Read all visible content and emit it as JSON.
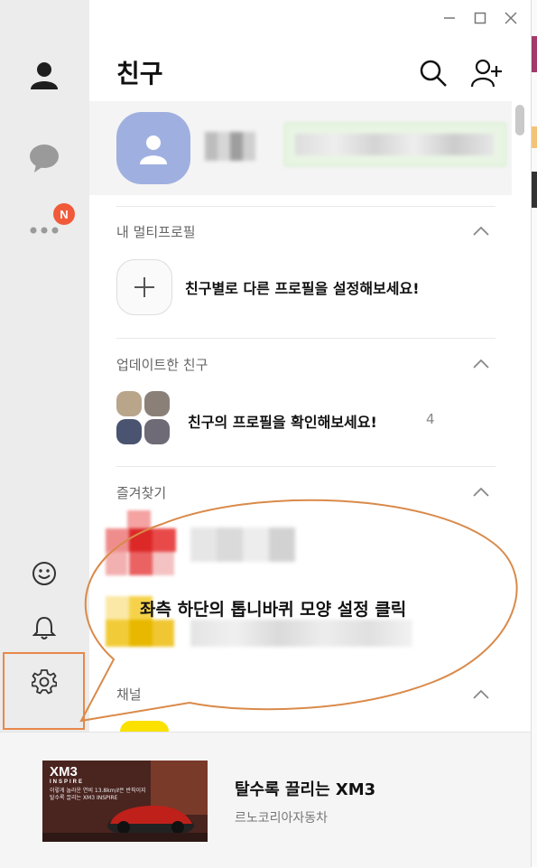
{
  "window": {
    "minimize_icon": "minimize-icon",
    "maximize_icon": "maximize-icon",
    "close_icon": "close-icon"
  },
  "rail": {
    "friends_icon": "person-icon",
    "chats_icon": "chat-bubble-icon",
    "more_icon": "more-dots-icon",
    "more_badge": "N",
    "emoticon_icon": "smile-icon",
    "notification_icon": "bell-icon",
    "settings_icon": "gear-icon",
    "accent": "#f05a3a"
  },
  "header": {
    "title": "친구"
  },
  "sections": {
    "multi_profile": {
      "title": "내 멀티프로필",
      "cta": "친구별로 다른 프로필을 설정해보세요!"
    },
    "updated": {
      "title": "업데이트한 친구",
      "cta": "친구의 프로필을 확인해보세요!",
      "count": "4"
    },
    "favorites": {
      "title": "즐겨찾기"
    },
    "channel": {
      "title": "채널"
    }
  },
  "callout": {
    "text": "좌측 하단의 톱니바퀴 모양 설정 클릭",
    "stroke": "#d98a4a"
  },
  "ad": {
    "banner_logo": "XM3",
    "banner_logo_sub": "INSPIRE",
    "banner_text_1": "이렇게 놀라운 연비 13.8km/ℓ은 반칙이지",
    "banner_text_2": "탈수록 끌리는 XM3 INSPIRE",
    "title": "탈수록 끌리는 XM3",
    "subtitle": "르노코리아자동차"
  }
}
